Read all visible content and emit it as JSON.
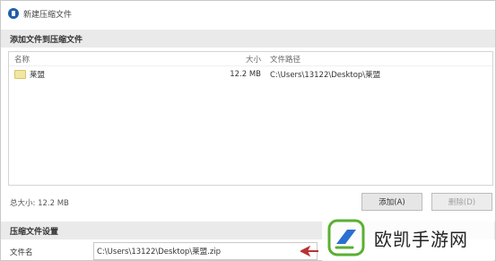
{
  "window": {
    "title": "新建压缩文件"
  },
  "add_section": {
    "header": "添加文件到压缩文件",
    "columns": {
      "name": "名称",
      "size": "大小",
      "path": "文件路径"
    },
    "rows": [
      {
        "name": "莱盟",
        "size": "12.2 MB",
        "path": "C:\\Users\\13122\\Desktop\\莱盟"
      }
    ],
    "total_size": "总大小: 12.2 MB",
    "add_button": "添加(A)",
    "remove_button": "删除(D)"
  },
  "compress_section": {
    "header": "压缩文件设置",
    "filename_label": "文件名",
    "filename_value": "C:\\Users\\13122\\Desktop\\莱盟.zip"
  },
  "watermark": {
    "text": "欧凯手游网",
    "colors": {
      "green": "#5ab031",
      "blue": "#2b6fd1"
    }
  }
}
